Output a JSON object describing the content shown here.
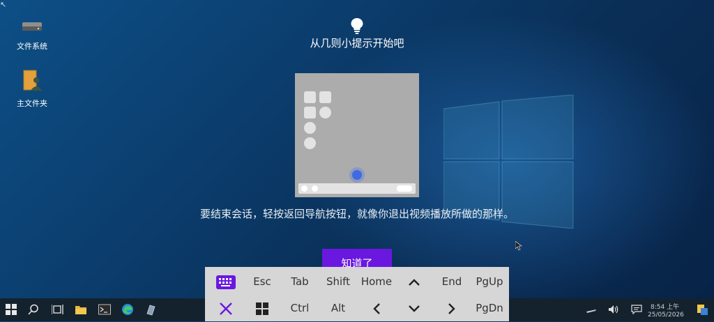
{
  "desktop": {
    "icons": [
      {
        "label": "文件系统",
        "icon": "drive-icon"
      },
      {
        "label": "主文件夹",
        "icon": "home-folder-icon"
      }
    ]
  },
  "tip": {
    "title": "从几则小提示开始吧",
    "body": "要结束会话，轻按返回导航按钮，就像你退出视频播放所做的那样。",
    "button_label": "知道了",
    "accent": "#6a18e0"
  },
  "keyboard": {
    "row1": [
      "Esc",
      "Tab",
      "Shift",
      "Home",
      "End",
      "PgUp"
    ],
    "row2": [
      "Ctrl",
      "Alt",
      "PgDn"
    ],
    "icons": [
      "keyboard-icon",
      "close-icon",
      "windows-key-icon",
      "arrow-up-icon",
      "arrow-left-icon",
      "arrow-down-icon",
      "arrow-right-icon"
    ]
  },
  "taskbar": {
    "time": "8:54 上午",
    "date": "25/05/2026",
    "icons": [
      "start-icon",
      "search-icon",
      "task-view-icon",
      "file-explorer-icon",
      "terminal-icon",
      "edge-icon",
      "app-icon",
      "network-icon",
      "volume-icon",
      "notification-icon",
      "user-icon"
    ]
  }
}
